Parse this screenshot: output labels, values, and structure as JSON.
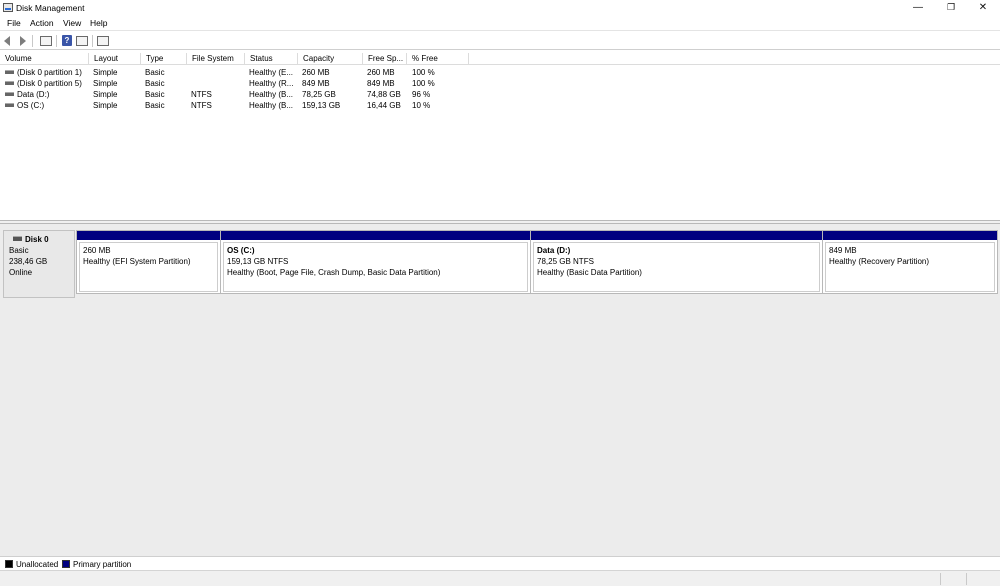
{
  "window": {
    "title": "Disk Management"
  },
  "menu": [
    "File",
    "Action",
    "View",
    "Help"
  ],
  "toolbar": [
    "back-arrow-icon",
    "forward-arrow-icon",
    "show-hide-console-tree-icon",
    "help-icon",
    "properties-icon",
    "console-view-icon"
  ],
  "volume_list": {
    "columns": [
      "Volume",
      "Layout",
      "Type",
      "File System",
      "Status",
      "Capacity",
      "Free Sp...",
      "% Free"
    ],
    "rows": [
      {
        "volume": "(Disk 0 partition 1)",
        "layout": "Simple",
        "type": "Basic",
        "fs": "",
        "status": "Healthy (E...",
        "capacity": "260 MB",
        "free": "260 MB",
        "pct": "100 %"
      },
      {
        "volume": "(Disk 0 partition 5)",
        "layout": "Simple",
        "type": "Basic",
        "fs": "",
        "status": "Healthy (R...",
        "capacity": "849 MB",
        "free": "849 MB",
        "pct": "100 %"
      },
      {
        "volume": "Data (D:)",
        "layout": "Simple",
        "type": "Basic",
        "fs": "NTFS",
        "status": "Healthy (B...",
        "capacity": "78,25 GB",
        "free": "74,88 GB",
        "pct": "96 %"
      },
      {
        "volume": "OS (C:)",
        "layout": "Simple",
        "type": "Basic",
        "fs": "NTFS",
        "status": "Healthy (B...",
        "capacity": "159,13 GB",
        "free": "16,44 GB",
        "pct": "10 %"
      }
    ]
  },
  "disk": {
    "name": "Disk 0",
    "type": "Basic",
    "size": "238,46 GB",
    "state": "Online",
    "partitions": [
      {
        "name": "",
        "size": "260 MB",
        "status": "Healthy (EFI System Partition)"
      },
      {
        "name": "OS  (C:)",
        "size": "159,13 GB NTFS",
        "status": "Healthy (Boot, Page File, Crash Dump, Basic Data Partition)"
      },
      {
        "name": "Data  (D:)",
        "size": "78,25 GB NTFS",
        "status": "Healthy (Basic Data Partition)"
      },
      {
        "name": "",
        "size": "849 MB",
        "status": "Healthy (Recovery Partition)"
      }
    ]
  },
  "legend": {
    "unallocated": "Unallocated",
    "primary": "Primary partition",
    "colors": {
      "unallocated": "#000000",
      "primary": "#000080"
    }
  }
}
